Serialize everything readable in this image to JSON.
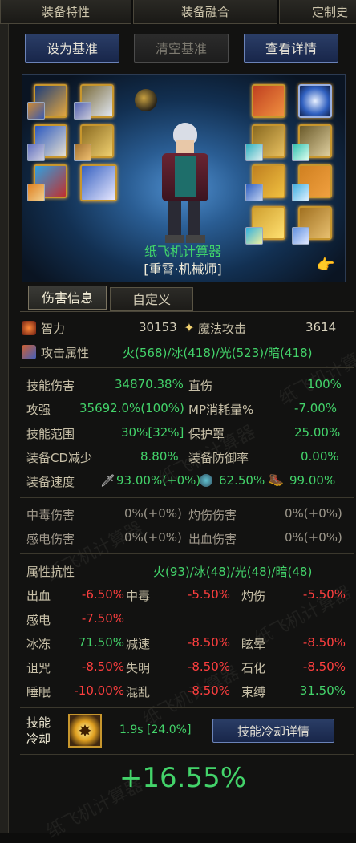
{
  "top_tabs": [
    "装备特性",
    "装备融合",
    "定制史"
  ],
  "buttons": {
    "set_base": "设为基准",
    "clear_base": "清空基准",
    "view_detail": "查看详情"
  },
  "character": {
    "calc_name": "纸飞机计算器",
    "name": "[重霄·机械师]"
  },
  "sub_tabs": {
    "damage": "伤害信息",
    "custom": "自定义"
  },
  "stats": {
    "int_label": "智力",
    "int_value": "30153",
    "matk_label": "魔法攻击",
    "matk_value": "3614",
    "attr_label": "攻击属性",
    "attr_value": "火(568)/冰(418)/光(523)/暗(418)",
    "skill_dmg_label": "技能伤害",
    "skill_dmg_value": "34870.38%",
    "direct_label": "直伤",
    "direct_value": "100%",
    "atk_strength_label": "攻强",
    "atk_strength_value": "35692.0%(100%)",
    "mp_label": "MP消耗量%",
    "mp_value": "-7.00%",
    "range_label": "技能范围",
    "range_value": "30%[32%]",
    "shield_label": "保护罩",
    "shield_value": "25.00%",
    "cd_label": "装备CD减少",
    "cd_value": "8.80%",
    "def_label": "装备防御率",
    "def_value": "0.00%",
    "speed_label": "装备速度",
    "speed_atk": "93.00%(+0%)",
    "speed_cast": "62.50%",
    "speed_move": "99.00%"
  },
  "dot": {
    "poison_label": "中毒伤害",
    "poison_value": "0%(+0%)",
    "burn_label": "灼伤伤害",
    "burn_value": "0%(+0%)",
    "shock_label": "感电伤害",
    "shock_value": "0%(+0%)",
    "bleed_label": "出血伤害",
    "bleed_value": "0%(+0%)"
  },
  "resist": {
    "title": "属性抗性",
    "value": "火(93)/冰(48)/光(48)/暗(48)",
    "rows": [
      [
        [
          "出血",
          "-6.50%",
          "r"
        ],
        [
          "中毒",
          "-5.50%",
          "r"
        ],
        [
          "灼伤",
          "-5.50%",
          "r"
        ]
      ],
      [
        [
          "感电",
          "-7.50%",
          "r"
        ]
      ],
      [
        [
          "冰冻",
          "71.50%",
          "g"
        ],
        [
          "减速",
          "-8.50%",
          "r"
        ],
        [
          "眩晕",
          "-8.50%",
          "r"
        ]
      ],
      [
        [
          "诅咒",
          "-8.50%",
          "r"
        ],
        [
          "失明",
          "-8.50%",
          "r"
        ],
        [
          "石化",
          "-8.50%",
          "r"
        ]
      ],
      [
        [
          "睡眠",
          "-10.00%",
          "r"
        ],
        [
          "混乱",
          "-8.50%",
          "r"
        ],
        [
          "束缚",
          "31.50%",
          "g"
        ]
      ]
    ]
  },
  "cooldown": {
    "label_line1": "技能",
    "label_line2": "冷却",
    "value": "1.9s [24.0%]",
    "button": "技能冷却详情"
  },
  "total": "+16.55%",
  "watermark": "纸飞机计算器",
  "colors": {
    "accent_green": "#43d36a",
    "negative_red": "#ff3f3f",
    "button_blue": "#2a3d66",
    "gold_border": "#c7962d"
  }
}
